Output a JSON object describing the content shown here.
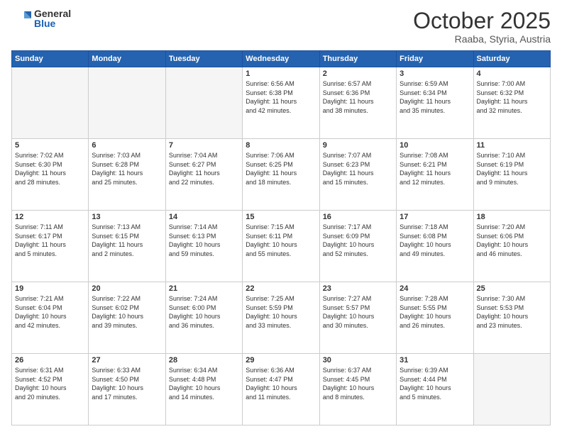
{
  "logo": {
    "general": "General",
    "blue": "Blue"
  },
  "header": {
    "month": "October 2025",
    "location": "Raaba, Styria, Austria"
  },
  "weekdays": [
    "Sunday",
    "Monday",
    "Tuesday",
    "Wednesday",
    "Thursday",
    "Friday",
    "Saturday"
  ],
  "weeks": [
    [
      {
        "day": "",
        "text": ""
      },
      {
        "day": "",
        "text": ""
      },
      {
        "day": "",
        "text": ""
      },
      {
        "day": "1",
        "text": "Sunrise: 6:56 AM\nSunset: 6:38 PM\nDaylight: 11 hours\nand 42 minutes."
      },
      {
        "day": "2",
        "text": "Sunrise: 6:57 AM\nSunset: 6:36 PM\nDaylight: 11 hours\nand 38 minutes."
      },
      {
        "day": "3",
        "text": "Sunrise: 6:59 AM\nSunset: 6:34 PM\nDaylight: 11 hours\nand 35 minutes."
      },
      {
        "day": "4",
        "text": "Sunrise: 7:00 AM\nSunset: 6:32 PM\nDaylight: 11 hours\nand 32 minutes."
      }
    ],
    [
      {
        "day": "5",
        "text": "Sunrise: 7:02 AM\nSunset: 6:30 PM\nDaylight: 11 hours\nand 28 minutes."
      },
      {
        "day": "6",
        "text": "Sunrise: 7:03 AM\nSunset: 6:28 PM\nDaylight: 11 hours\nand 25 minutes."
      },
      {
        "day": "7",
        "text": "Sunrise: 7:04 AM\nSunset: 6:27 PM\nDaylight: 11 hours\nand 22 minutes."
      },
      {
        "day": "8",
        "text": "Sunrise: 7:06 AM\nSunset: 6:25 PM\nDaylight: 11 hours\nand 18 minutes."
      },
      {
        "day": "9",
        "text": "Sunrise: 7:07 AM\nSunset: 6:23 PM\nDaylight: 11 hours\nand 15 minutes."
      },
      {
        "day": "10",
        "text": "Sunrise: 7:08 AM\nSunset: 6:21 PM\nDaylight: 11 hours\nand 12 minutes."
      },
      {
        "day": "11",
        "text": "Sunrise: 7:10 AM\nSunset: 6:19 PM\nDaylight: 11 hours\nand 9 minutes."
      }
    ],
    [
      {
        "day": "12",
        "text": "Sunrise: 7:11 AM\nSunset: 6:17 PM\nDaylight: 11 hours\nand 5 minutes."
      },
      {
        "day": "13",
        "text": "Sunrise: 7:13 AM\nSunset: 6:15 PM\nDaylight: 11 hours\nand 2 minutes."
      },
      {
        "day": "14",
        "text": "Sunrise: 7:14 AM\nSunset: 6:13 PM\nDaylight: 10 hours\nand 59 minutes."
      },
      {
        "day": "15",
        "text": "Sunrise: 7:15 AM\nSunset: 6:11 PM\nDaylight: 10 hours\nand 55 minutes."
      },
      {
        "day": "16",
        "text": "Sunrise: 7:17 AM\nSunset: 6:09 PM\nDaylight: 10 hours\nand 52 minutes."
      },
      {
        "day": "17",
        "text": "Sunrise: 7:18 AM\nSunset: 6:08 PM\nDaylight: 10 hours\nand 49 minutes."
      },
      {
        "day": "18",
        "text": "Sunrise: 7:20 AM\nSunset: 6:06 PM\nDaylight: 10 hours\nand 46 minutes."
      }
    ],
    [
      {
        "day": "19",
        "text": "Sunrise: 7:21 AM\nSunset: 6:04 PM\nDaylight: 10 hours\nand 42 minutes."
      },
      {
        "day": "20",
        "text": "Sunrise: 7:22 AM\nSunset: 6:02 PM\nDaylight: 10 hours\nand 39 minutes."
      },
      {
        "day": "21",
        "text": "Sunrise: 7:24 AM\nSunset: 6:00 PM\nDaylight: 10 hours\nand 36 minutes."
      },
      {
        "day": "22",
        "text": "Sunrise: 7:25 AM\nSunset: 5:59 PM\nDaylight: 10 hours\nand 33 minutes."
      },
      {
        "day": "23",
        "text": "Sunrise: 7:27 AM\nSunset: 5:57 PM\nDaylight: 10 hours\nand 30 minutes."
      },
      {
        "day": "24",
        "text": "Sunrise: 7:28 AM\nSunset: 5:55 PM\nDaylight: 10 hours\nand 26 minutes."
      },
      {
        "day": "25",
        "text": "Sunrise: 7:30 AM\nSunset: 5:53 PM\nDaylight: 10 hours\nand 23 minutes."
      }
    ],
    [
      {
        "day": "26",
        "text": "Sunrise: 6:31 AM\nSunset: 4:52 PM\nDaylight: 10 hours\nand 20 minutes."
      },
      {
        "day": "27",
        "text": "Sunrise: 6:33 AM\nSunset: 4:50 PM\nDaylight: 10 hours\nand 17 minutes."
      },
      {
        "day": "28",
        "text": "Sunrise: 6:34 AM\nSunset: 4:48 PM\nDaylight: 10 hours\nand 14 minutes."
      },
      {
        "day": "29",
        "text": "Sunrise: 6:36 AM\nSunset: 4:47 PM\nDaylight: 10 hours\nand 11 minutes."
      },
      {
        "day": "30",
        "text": "Sunrise: 6:37 AM\nSunset: 4:45 PM\nDaylight: 10 hours\nand 8 minutes."
      },
      {
        "day": "31",
        "text": "Sunrise: 6:39 AM\nSunset: 4:44 PM\nDaylight: 10 hours\nand 5 minutes."
      },
      {
        "day": "",
        "text": ""
      }
    ]
  ]
}
